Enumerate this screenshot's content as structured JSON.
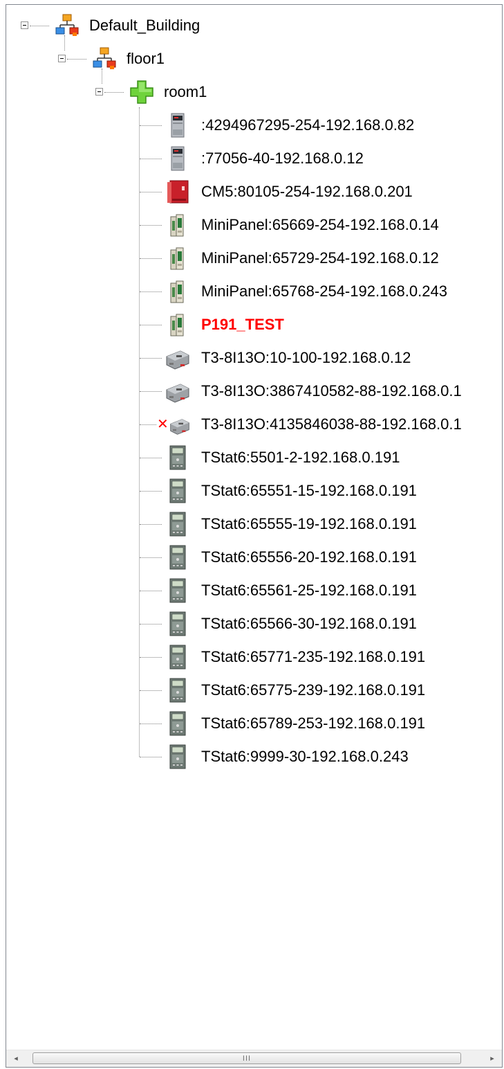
{
  "tree": {
    "building": {
      "label": "Default_Building",
      "icon": "network-building-icon"
    },
    "floor": {
      "label": "floor1",
      "icon": "network-building-icon"
    },
    "room": {
      "label": "room1",
      "icon": "green-plus-icon"
    },
    "devices": [
      {
        "label": ":4294967295-254-192.168.0.82",
        "icon": "gray-controller-icon",
        "red": false,
        "offline": false
      },
      {
        "label": ":77056-40-192.168.0.12",
        "icon": "gray-controller-icon",
        "red": false,
        "offline": false
      },
      {
        "label": "CM5:80105-254-192.168.0.201",
        "icon": "red-cabinet-icon",
        "red": false,
        "offline": false
      },
      {
        "label": "MiniPanel:65669-254-192.168.0.14",
        "icon": "minipanel-icon",
        "red": false,
        "offline": false
      },
      {
        "label": "MiniPanel:65729-254-192.168.0.12",
        "icon": "minipanel-icon",
        "red": false,
        "offline": false
      },
      {
        "label": "MiniPanel:65768-254-192.168.0.243",
        "icon": "minipanel-icon",
        "red": false,
        "offline": false
      },
      {
        "label": "P191_TEST",
        "icon": "minipanel-icon",
        "red": true,
        "offline": false
      },
      {
        "label": "T3-8I13O:10-100-192.168.0.12",
        "icon": "t3-module-icon",
        "red": false,
        "offline": false
      },
      {
        "label": "T3-8I13O:3867410582-88-192.168.0.1",
        "icon": "t3-module-icon",
        "red": false,
        "offline": false
      },
      {
        "label": "T3-8I13O:4135846038-88-192.168.0.1",
        "icon": "t3-module-icon",
        "red": false,
        "offline": true
      },
      {
        "label": "TStat6:5501-2-192.168.0.191",
        "icon": "tstat-icon",
        "red": false,
        "offline": false
      },
      {
        "label": "TStat6:65551-15-192.168.0.191",
        "icon": "tstat-icon",
        "red": false,
        "offline": false
      },
      {
        "label": "TStat6:65555-19-192.168.0.191",
        "icon": "tstat-icon",
        "red": false,
        "offline": false
      },
      {
        "label": "TStat6:65556-20-192.168.0.191",
        "icon": "tstat-icon",
        "red": false,
        "offline": false
      },
      {
        "label": "TStat6:65561-25-192.168.0.191",
        "icon": "tstat-icon",
        "red": false,
        "offline": false
      },
      {
        "label": "TStat6:65566-30-192.168.0.191",
        "icon": "tstat-icon",
        "red": false,
        "offline": false
      },
      {
        "label": "TStat6:65771-235-192.168.0.191",
        "icon": "tstat-icon",
        "red": false,
        "offline": false
      },
      {
        "label": "TStat6:65775-239-192.168.0.191",
        "icon": "tstat-icon",
        "red": false,
        "offline": false
      },
      {
        "label": "TStat6:65789-253-192.168.0.191",
        "icon": "tstat-icon",
        "red": false,
        "offline": false
      },
      {
        "label": "TStat6:9999-30-192.168.0.243",
        "icon": "tstat-icon",
        "red": false,
        "offline": false
      }
    ]
  },
  "scrollbar": {
    "left_arrow": "◂",
    "right_arrow": "▸",
    "grip": "III"
  },
  "colors": {
    "highlight_text": "#ff0000",
    "offline_mark": "#ff0000"
  }
}
